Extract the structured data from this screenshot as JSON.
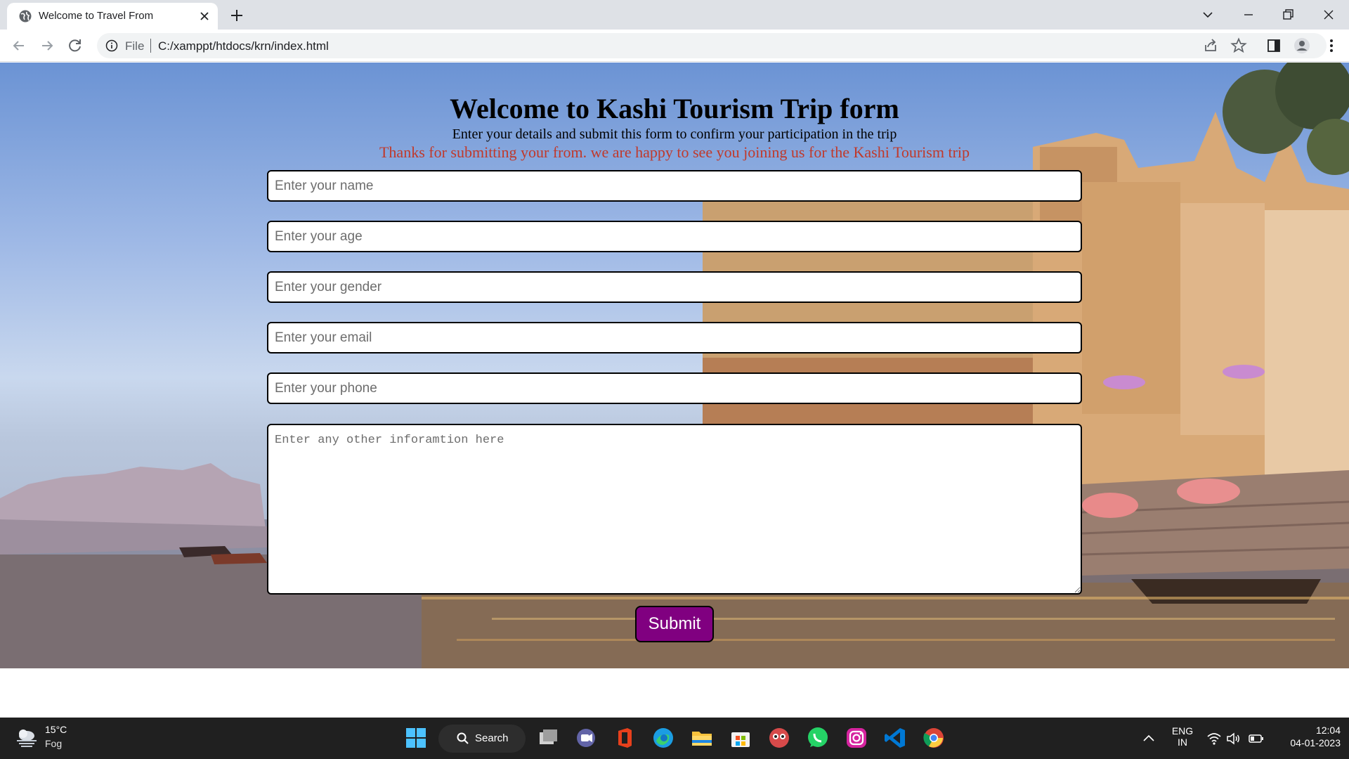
{
  "browser": {
    "tab_title": "Welcome to Travel From",
    "address_scheme": "File",
    "address_url": "C:/xamppt/htdocs/krn/index.html"
  },
  "page": {
    "title": "Welcome to Kashi Tourism Trip form",
    "subtitle": "Enter your details and submit this form to confirm your participation in the trip",
    "thanks_message": "Thanks for submitting your from. we are happy to see you joining us for the Kashi Tourism trip",
    "thanks_color": "#c0392b",
    "fields": {
      "name_placeholder": "Enter your name",
      "age_placeholder": "Enter your age",
      "gender_placeholder": "Enter your gender",
      "email_placeholder": "Enter your email",
      "phone_placeholder": "Enter your phone",
      "info_placeholder": "Enter any other inforamtion here"
    },
    "submit_label": "Submit",
    "submit_color": "#800080"
  },
  "taskbar": {
    "weather_temp": "15°C",
    "weather_condition": "Fog",
    "search_label": "Search",
    "language_line1": "ENG",
    "language_line2": "IN",
    "time": "12:04",
    "date": "04-01-2023",
    "pinned_apps": [
      "windows-start",
      "search",
      "task-view",
      "teams-chat",
      "office",
      "edge",
      "file-explorer",
      "microsoft-store",
      "game-app",
      "whatsapp",
      "instagram",
      "vscode",
      "chrome"
    ]
  }
}
